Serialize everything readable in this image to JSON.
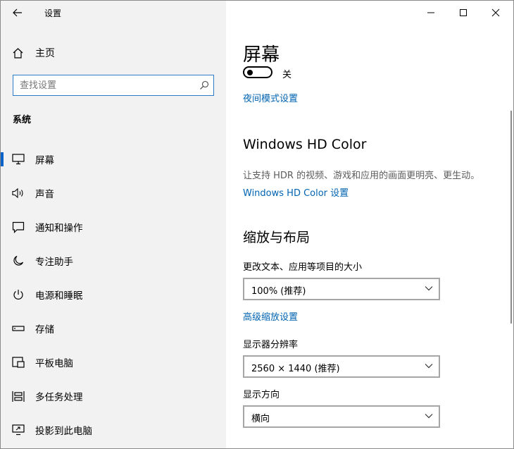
{
  "window": {
    "title": "设置"
  },
  "sidebar": {
    "home_label": "主页",
    "search_placeholder": "查找设置",
    "section_label": "系统",
    "items": [
      {
        "label": "屏幕",
        "icon": "monitor-icon",
        "selected": true
      },
      {
        "label": "声音",
        "icon": "speaker-icon",
        "selected": false
      },
      {
        "label": "通知和操作",
        "icon": "notification-icon",
        "selected": false
      },
      {
        "label": "专注助手",
        "icon": "moon-icon",
        "selected": false
      },
      {
        "label": "电源和睡眠",
        "icon": "power-icon",
        "selected": false
      },
      {
        "label": "存储",
        "icon": "storage-icon",
        "selected": false
      },
      {
        "label": "平板电脑",
        "icon": "tablet-icon",
        "selected": false
      },
      {
        "label": "多任务处理",
        "icon": "multitask-icon",
        "selected": false
      },
      {
        "label": "投影到此电脑",
        "icon": "project-icon",
        "selected": false
      }
    ]
  },
  "main": {
    "title": "屏幕",
    "night_light_toggle_state": "关",
    "night_light_settings_link": "夜间模式设置",
    "hd_color": {
      "heading": "Windows HD Color",
      "description": "让支持 HDR 的视频、游戏和应用的画面更明亮、更生动。",
      "settings_link": "Windows HD Color 设置"
    },
    "scale_layout": {
      "heading": "缩放与布局",
      "text_size_label": "更改文本、应用等项目的大小",
      "text_size_value": "100% (推荐)",
      "advanced_scaling_link": "高级缩放设置",
      "resolution_label": "显示器分辨率",
      "resolution_value": "2560 × 1440 (推荐)",
      "orientation_label": "显示方向",
      "orientation_value": "横向"
    }
  },
  "colors": {
    "accent": "#0a63c9",
    "link": "#0063b1",
    "sidebar_bg": "#f2f2f2"
  }
}
